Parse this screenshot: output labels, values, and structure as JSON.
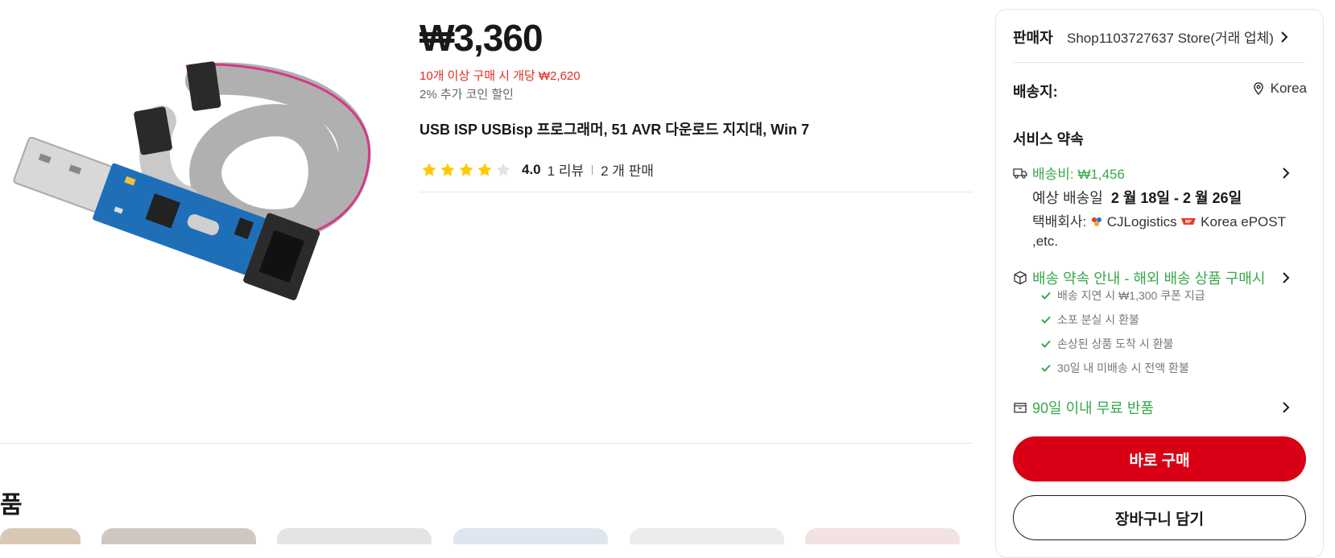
{
  "product": {
    "image_alt": "USBasp programmer with grey ribbon cable",
    "price": "₩3,360",
    "bulk_price_text": "10개 이상 구매 시 개당 ₩2,620",
    "coin_discount": "2% 추가 코인 할인",
    "title": "USB ISP USBisp 프로그래머, 51 AVR 다운로드 지지대, Win 7",
    "rating": "4.0",
    "reviews": "1 리뷰",
    "sold": "2 개 판매",
    "stars_filled": 4,
    "stars_total": 5
  },
  "related": {
    "title": "품"
  },
  "panel": {
    "seller_label": "판매자",
    "seller_name": "Shop1103727637 Store(거래 업체)",
    "ship_label": "배송지:",
    "ship_dest": "Korea",
    "service_title": "서비스 약속",
    "shipping_fee": "배송비: ₩1,456",
    "eta_prefix": "예상 배송일",
    "eta_range": "2 월 18일 - 2 월 26일",
    "carrier_label": "택배회사:",
    "carrier_1": "CJLogistics",
    "carrier_2": "Korea ePOST ,etc.",
    "promise_title": "배송 약속 안내 - 해외 배송 상품 구매시",
    "promise_items": [
      "배송 지연 시 ₩1,300 쿠폰 지급",
      "소포 분실 시 환불",
      "손상된 상품 도착 시 환불",
      "30일 내 미배송 시 전액 환불"
    ],
    "return_text": "90일 이내 무료 반품",
    "buy_now": "바로 구매",
    "add_cart": "장바구니 담기"
  },
  "colors": {
    "accent_red": "#d90015",
    "price_red": "#e02a24",
    "service_green": "#38a84a",
    "star_yellow": "#ffc800"
  }
}
